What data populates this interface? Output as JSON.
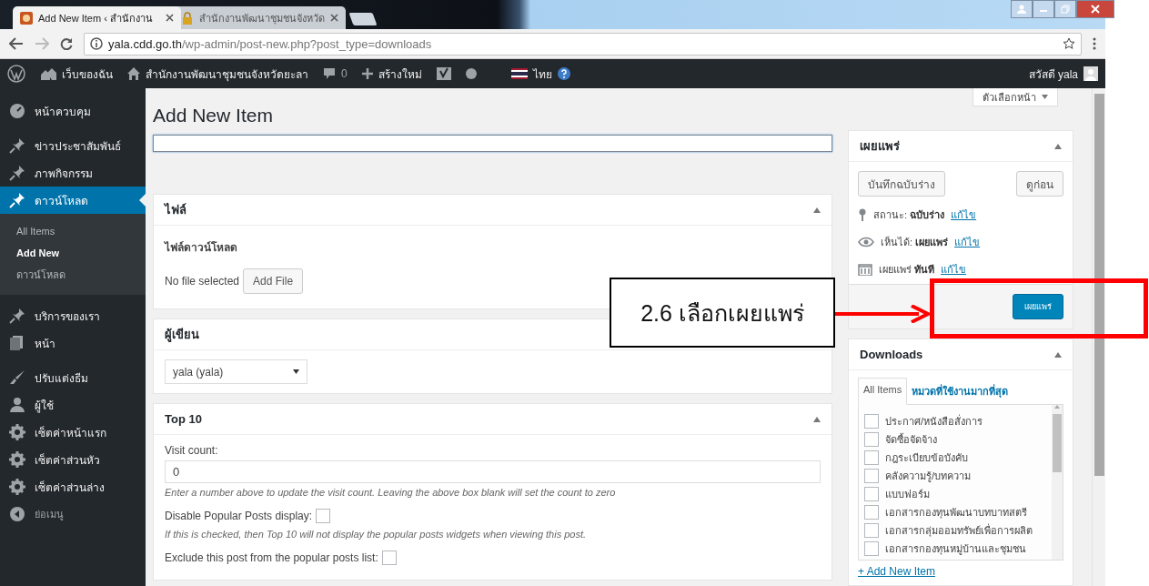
{
  "browser": {
    "tabs": [
      {
        "title": "Add New Item ‹ สำนักงาน",
        "selected": true
      },
      {
        "title": "สำนักงานพัฒนาชุมชนจังหวัด",
        "selected": false
      }
    ],
    "url_host": "yala.cdd.go.th",
    "url_path": "/wp-admin/post-new.php?post_type=downloads"
  },
  "admin_bar": {
    "my_sites": "เว็บของฉัน",
    "site_name": "สำนักงานพัฒนาชุมชนจังหวัดยะลา",
    "comments": "0",
    "new": "สร้างใหม่",
    "language": "ไทย",
    "greeting": "สวัสดี yala"
  },
  "sidebar": {
    "items": [
      {
        "kind": "dashboard",
        "label": "หน้าควบคุม",
        "selected": false
      },
      {
        "kind": "pin",
        "label": "ข่าวประชาสัมพันธ์",
        "selected": false
      },
      {
        "kind": "pin",
        "label": "ภาพกิจกรรม",
        "selected": false
      },
      {
        "kind": "pin",
        "label": "ดาวน์โหลด",
        "selected": true,
        "children": [
          {
            "label": "All Items",
            "selected": false
          },
          {
            "label": "Add New",
            "selected": true
          },
          {
            "label": "ดาวน์โหลด",
            "selected": false
          }
        ]
      },
      {
        "kind": "pin",
        "label": "บริการของเรา",
        "selected": false
      },
      {
        "kind": "page",
        "label": "หน้า",
        "selected": false
      },
      {
        "kind": "brush",
        "label": "ปรับแต่งธีม",
        "selected": false
      },
      {
        "kind": "user",
        "label": "ผู้ใช้",
        "selected": false
      },
      {
        "kind": "gear",
        "label": "เซ็ตค่าหน้าแรก",
        "selected": false
      },
      {
        "kind": "gear",
        "label": "เซ็ตค่าส่วนหัว",
        "selected": false
      },
      {
        "kind": "gear",
        "label": "เซ็ตค่าส่วนล่าง",
        "selected": false
      },
      {
        "kind": "collapse",
        "label": "ย่อเมนู",
        "selected": false
      }
    ]
  },
  "screen_options": "ตัวเลือกหน้า",
  "page_title": "Add New Item",
  "file_box": {
    "title": "ไฟล์",
    "field_label": "ไฟล์ดาวน์โหลด",
    "status": "No file selected",
    "button": "Add File"
  },
  "author_box": {
    "title": "ผู้เขียน",
    "value": "yala (yala)"
  },
  "top10_box": {
    "title": "Top 10",
    "visit_label": "Visit count:",
    "visit_value": "0",
    "visit_help": "Enter a number above to update the visit count. Leaving the above box blank will set the count to zero",
    "disable_label": "Disable Popular Posts display:",
    "disable_checked": false,
    "disable_help": "If this is checked, then Top 10 will not display the popular posts widgets when viewing this post.",
    "exclude_label": "Exclude this post from the popular posts list:",
    "exclude_checked": false
  },
  "publish_box": {
    "title": "เผยแพร่",
    "save_draft": "บันทึกฉบับร่าง",
    "preview": "ดูก่อน",
    "rows": [
      {
        "kind": "status",
        "label": "สถานะ:",
        "value": "ฉบับร่าง",
        "link": "แก้ไข"
      },
      {
        "kind": "visibility",
        "label": "เห็นได้:",
        "value": "เผยแพร่",
        "link": "แก้ไข"
      },
      {
        "kind": "schedule",
        "label": "เผยแพร่",
        "value": "ทันที",
        "link": "แก้ไข"
      }
    ],
    "publish": "เผยแพร่"
  },
  "downloads_box": {
    "title": "Downloads",
    "tabs": [
      {
        "label": "All Items",
        "selected": true
      },
      {
        "label": "หมวดที่ใช้งานมากที่สุด",
        "selected": false
      }
    ],
    "categories": [
      {
        "label": "ประกาศ/หนังสือสั่งการ",
        "checked": false
      },
      {
        "label": "จัดซื้อจัดจ้าง",
        "checked": false
      },
      {
        "label": "กฎระเบียบข้อบังคับ",
        "checked": false
      },
      {
        "label": "คลังความรู้/บทความ",
        "checked": false
      },
      {
        "label": "แบบฟอร์ม",
        "checked": false
      },
      {
        "label": "เอกสารกองทุนพัฒนาบทบาทสตรี",
        "checked": false
      },
      {
        "label": "เอกสารกลุ่มออมทรัพย์เพื่อการผลิต",
        "checked": false
      },
      {
        "label": "เอกสารกองทุนหมู่บ้านและชุมชน",
        "checked": false
      }
    ],
    "add_new": "+ Add New Item"
  },
  "annotation": {
    "callout": "2.6 เลือกเผยแพร่"
  }
}
